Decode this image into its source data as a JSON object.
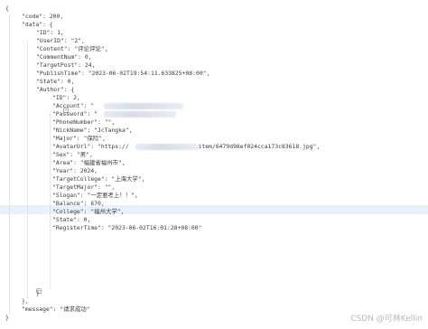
{
  "lines": [
    {
      "t": "{"
    },
    {
      "t": "\"code\": 200,"
    },
    {
      "t": "\"data\": {"
    },
    {
      "t": "\"ID\": 1,"
    },
    {
      "t": "\"UserID\": \"2\","
    },
    {
      "t": "\"Content\": \"评论评论\","
    },
    {
      "t": "\"CommentNum\": 0,"
    },
    {
      "t": "\"TargetPost\": 24,"
    },
    {
      "t": "\"PublishTime\": \"2023-06-02T19:54:11.633825+08:00\","
    },
    {
      "t": "\"State\": 0,"
    },
    {
      "t": "\"Author\": {"
    },
    {
      "t": "\"ID\": 2,"
    },
    {
      "t": "\"Account\": \"                    \","
    },
    {
      "t": "\"Password\": \"                  \","
    },
    {
      "t": "\"PhoneNumber\": \"\","
    },
    {
      "t": "\"NickName\": \"JcTangka\","
    },
    {
      "t": "\"Major\": \"保险\","
    },
    {
      "t": "\"AvatarUrl\": \"https://                    item/6479d98ef024cca173c83618.jpg\","
    },
    {
      "t": "\"Sex\": \"男\","
    },
    {
      "t": "\"Area\": \"福建省福州市\","
    },
    {
      "t": "\"Year\": 2024,"
    },
    {
      "t": "\"TargetCollege\": \"上海大学\","
    },
    {
      "t": "\"TargetMajor\": \"\","
    },
    {
      "t": "\"Slogan\": \"一定要考上！！\","
    },
    {
      "t": "\"Balance\": 670,"
    },
    {
      "t": "\"College\": \"福州大学\","
    },
    {
      "t": "\"State\": 0,"
    },
    {
      "t": "\"RegisterTime\": \"2023-06-02T16:01:28+08:00\""
    },
    {
      "t": "}"
    },
    {
      "t": "},"
    },
    {
      "t": "\"message\": \"请求成功\""
    },
    {
      "t": "}"
    }
  ],
  "watermark": "CSDN @可林Kellin"
}
